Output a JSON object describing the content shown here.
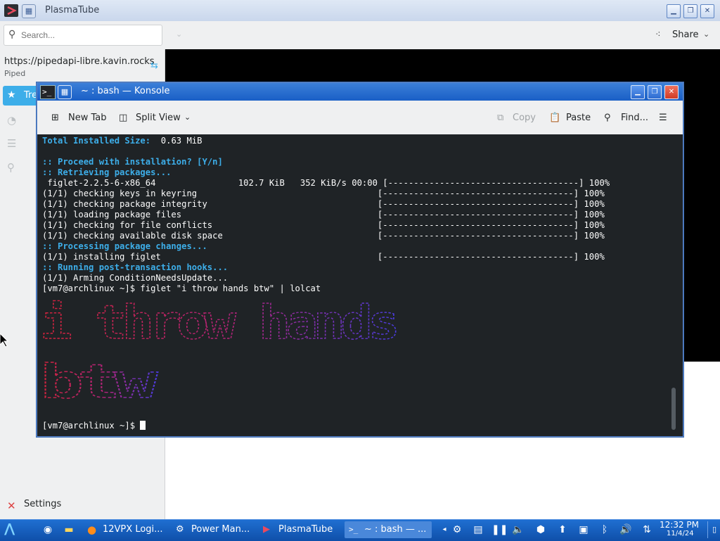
{
  "plasmatube": {
    "title": "PlasmaTube",
    "search_placeholder": "Search...",
    "share_label": "Share",
    "instance_url": "https://pipedapi-libre.kavin.rocks",
    "instance_type": "Piped",
    "nav": {
      "trending_label": "Tre"
    },
    "settings_label": "Settings"
  },
  "konsole": {
    "title": "~ : bash — Konsole",
    "toolbar": {
      "new_tab": "New Tab",
      "split_view": "Split View",
      "copy": "Copy",
      "paste": "Paste",
      "find": "Find..."
    },
    "terminal": {
      "total_size_label": "Total Installed Size:",
      "total_size_value": "0.63 MiB",
      "proceed": ":: Proceed with installation? [Y/n]",
      "retrieving": ":: Retrieving packages...",
      "download": " figlet-2.2.5-6-x86_64                102.7 KiB   352 KiB/s 00:00 [-------------------------------------] 100%",
      "steps": [
        "(1/1) checking keys in keyring                                   [-------------------------------------] 100%",
        "(1/1) checking package integrity                                 [-------------------------------------] 100%",
        "(1/1) loading package files                                      [-------------------------------------] 100%",
        "(1/1) checking for file conflicts                                [-------------------------------------] 100%",
        "(1/1) checking available disk space                              [-------------------------------------] 100%"
      ],
      "processing": ":: Processing package changes...",
      "installing": "(1/1) installing figlet                                          [-------------------------------------] 100%",
      "hooks": ":: Running post-transaction hooks...",
      "arming": "(1/1) Arming ConditionNeedsUpdate...",
      "command": "[vm7@archlinux ~]$ figlet \"i throw hands btw\" | lolcat",
      "banner_line1": "i throw hands",
      "banner_line2": "btw",
      "prompt": "[vm7@archlinux ~]$ "
    }
  },
  "taskbar": {
    "tasks": [
      {
        "label": "12VPX Logi..."
      },
      {
        "label": "Power Man..."
      },
      {
        "label": "PlasmaTube"
      },
      {
        "label": "~ : bash — ..."
      }
    ],
    "clock_time": "12:32 PM",
    "clock_date": "11/4/24"
  },
  "colors": {
    "accent": "#3daee9",
    "taskbar": "#1a5fc6",
    "terminal_bg": "#1f2326",
    "banner_start": "#d2233c",
    "banner_end": "#4b3ce0"
  }
}
